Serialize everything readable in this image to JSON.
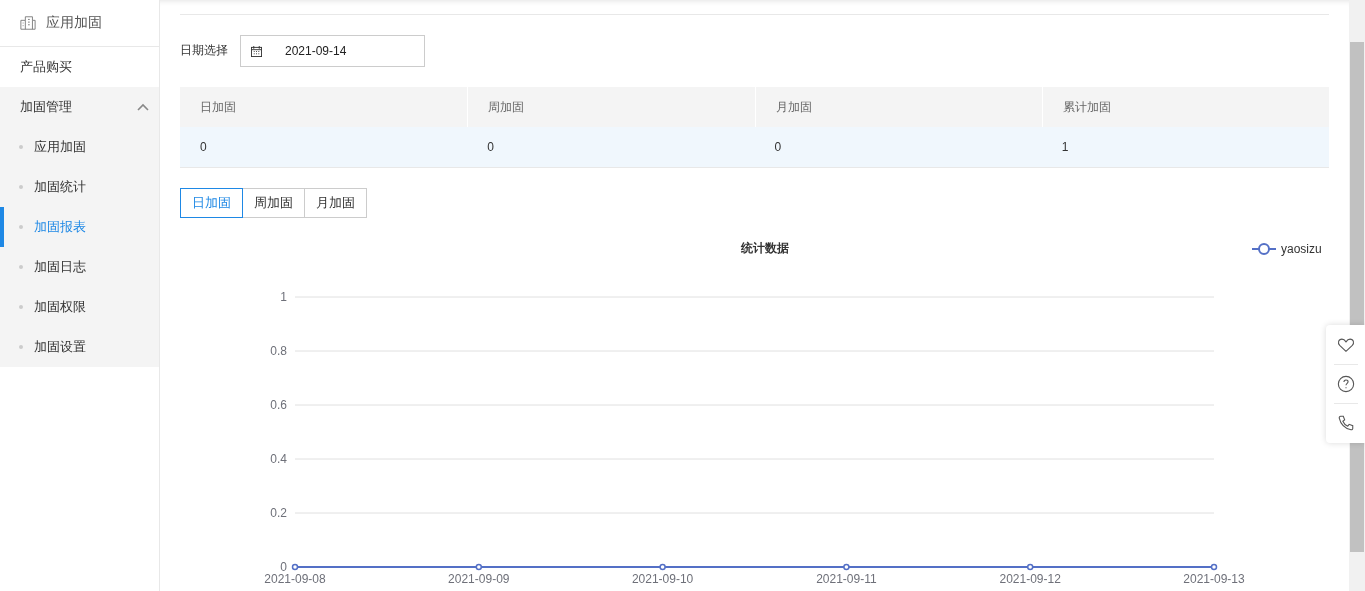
{
  "sidebar": {
    "header": "应用加固",
    "items": [
      {
        "label": "产品购买",
        "kind": "link"
      },
      {
        "label": "加固管理",
        "kind": "group",
        "expanded": true,
        "children": [
          {
            "label": "应用加固",
            "selected": false
          },
          {
            "label": "加固统计",
            "selected": false
          },
          {
            "label": "加固报表",
            "selected": true
          },
          {
            "label": "加固日志",
            "selected": false
          },
          {
            "label": "加固权限",
            "selected": false
          },
          {
            "label": "加固设置",
            "selected": false
          }
        ]
      }
    ]
  },
  "date_filter": {
    "label": "日期选择",
    "value": "2021-09-14"
  },
  "summary_table": {
    "columns": [
      "日加固",
      "周加固",
      "月加固",
      "累计加固"
    ],
    "rows": [
      [
        "0",
        "0",
        "0",
        "1"
      ]
    ]
  },
  "period_tabs": [
    {
      "label": "日加固",
      "selected": true
    },
    {
      "label": "周加固",
      "selected": false
    },
    {
      "label": "月加固",
      "selected": false
    }
  ],
  "chart_data": {
    "type": "line",
    "title": "统计数据",
    "categories": [
      "2021-09-08",
      "2021-09-09",
      "2021-09-10",
      "2021-09-11",
      "2021-09-12",
      "2021-09-13"
    ],
    "series": [
      {
        "name": "yaosizu",
        "color": "#5470c6",
        "marker": "circle",
        "values": [
          0,
          0,
          0,
          0,
          0,
          0
        ]
      }
    ],
    "ylim": [
      0,
      1
    ],
    "yticks": [
      0,
      0.2,
      0.4,
      0.6,
      0.8,
      1
    ],
    "grid": true
  }
}
